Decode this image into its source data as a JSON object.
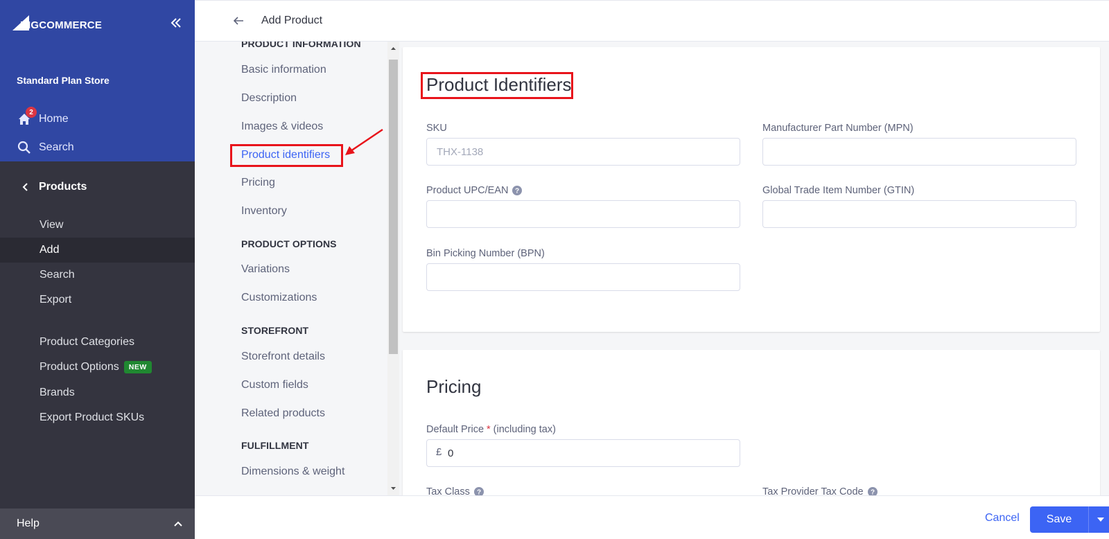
{
  "sidebar": {
    "logo_text": "BIGCOMMERCE",
    "store_name": "Standard Plan Store",
    "home_label": "Home",
    "home_badge": "2",
    "search_label": "Search",
    "section_title": "Products",
    "items": [
      {
        "label": "View"
      },
      {
        "label": "Add"
      },
      {
        "label": "Search"
      },
      {
        "label": "Export"
      },
      {
        "label": "Product Categories"
      },
      {
        "label": "Product Options",
        "badge": "NEW"
      },
      {
        "label": "Brands"
      },
      {
        "label": "Export Product SKUs"
      }
    ],
    "help_label": "Help",
    "colors": {
      "top": "#3047a3",
      "body": "#34343f",
      "active": "#2a2a33"
    }
  },
  "header": {
    "title": "Add Product"
  },
  "section_nav": {
    "groups": [
      {
        "title": "PRODUCT INFORMATION",
        "links": [
          "Basic information",
          "Description",
          "Images & videos",
          "Product identifiers",
          "Pricing",
          "Inventory"
        ]
      },
      {
        "title": "PRODUCT OPTIONS",
        "links": [
          "Variations",
          "Customizations"
        ]
      },
      {
        "title": "STOREFRONT",
        "links": [
          "Storefront details",
          "Custom fields",
          "Related products"
        ]
      },
      {
        "title": "FULFILLMENT",
        "links": [
          "Dimensions & weight"
        ]
      }
    ],
    "active_link": "Product identifiers"
  },
  "identifiers_card": {
    "title": "Product Identifiers",
    "sku_label": "SKU",
    "sku_placeholder": "THX-1138",
    "mpn_label": "Manufacturer Part Number (MPN)",
    "upc_label": "Product UPC/EAN",
    "gtin_label": "Global Trade Item Number (GTIN)",
    "bpn_label": "Bin Picking Number (BPN)"
  },
  "pricing_card": {
    "title": "Pricing",
    "price_label": "Default Price",
    "price_required": "*",
    "price_suffix": "(including tax)",
    "currency": "£",
    "price_value": "0",
    "tax_class_label": "Tax Class",
    "tax_code_label": "Tax Provider Tax Code"
  },
  "footer": {
    "cancel_label": "Cancel",
    "save_label": "Save"
  },
  "accent_color": "#3c64f4",
  "annotation_color": "#e8141b"
}
